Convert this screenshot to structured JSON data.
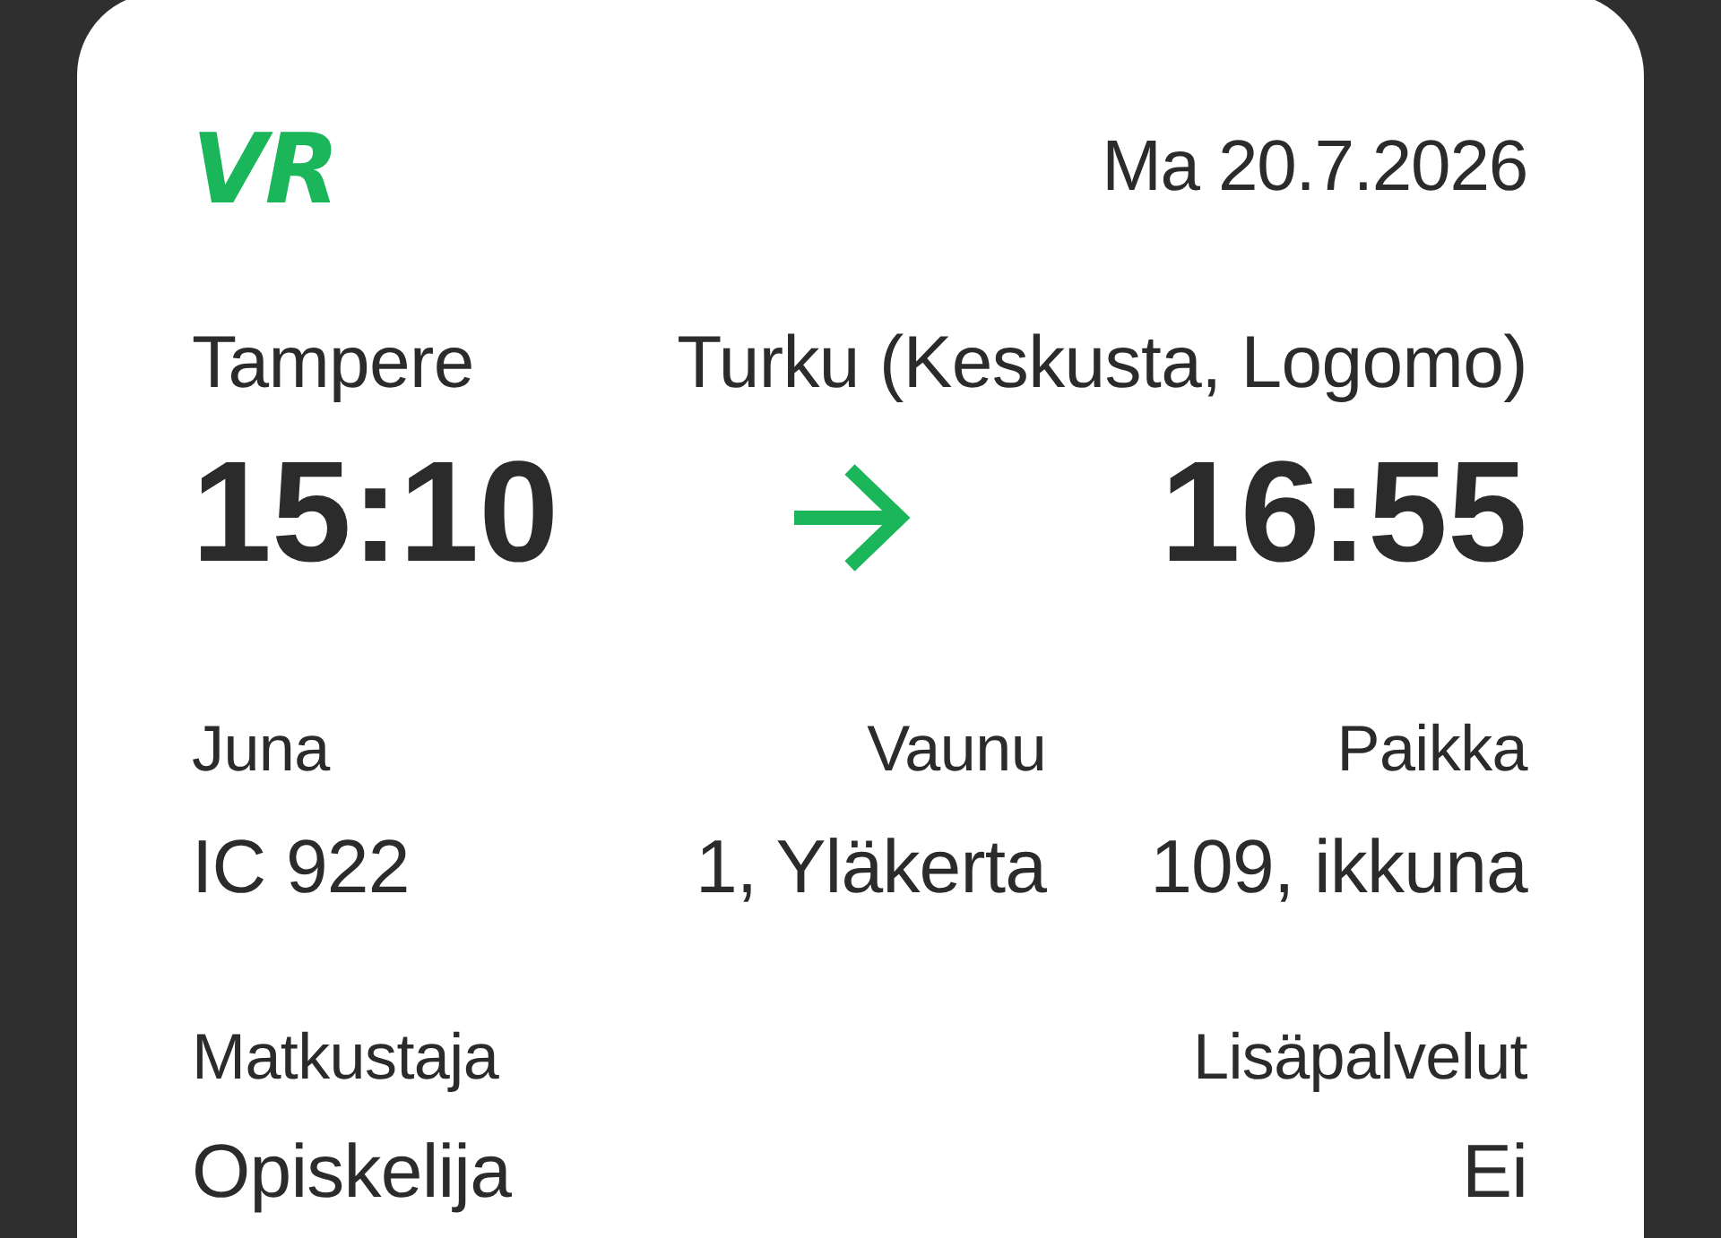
{
  "header": {
    "logo": "VR",
    "date": "Ma 20.7.2026"
  },
  "route": {
    "origin": {
      "station": "Tampere",
      "time": "15:10"
    },
    "destination": {
      "station": "Turku (Keskusta, Logomo)",
      "time": "16:55"
    }
  },
  "details": [
    {
      "label": "Juna",
      "value": "IC 922"
    },
    {
      "label": "Vaunu",
      "value": "1, Yläkerta"
    },
    {
      "label": "Paikka",
      "value": "109, ikkuna"
    }
  ],
  "extras": [
    {
      "label": "Matkustaja",
      "value": "Opiskelija"
    },
    {
      "label": "Lisäpalvelut",
      "value": "Ei"
    }
  ]
}
